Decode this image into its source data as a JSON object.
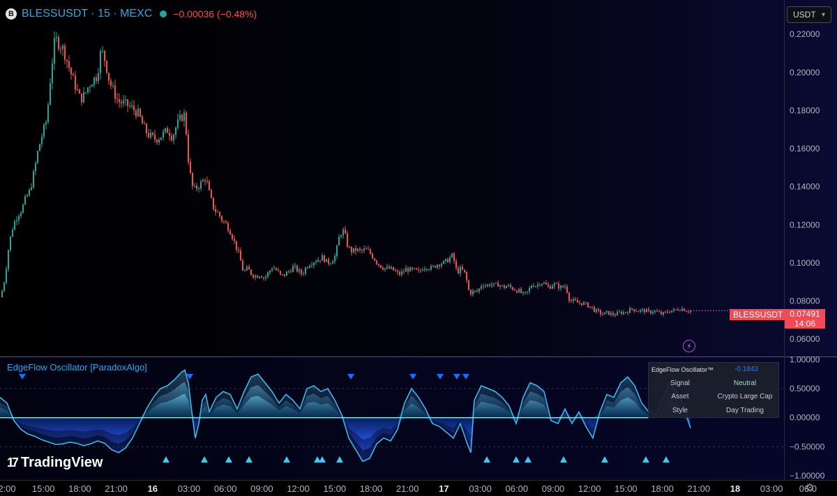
{
  "header": {
    "logo_letter": "B",
    "symbol": "BLESSUSDT · 15 · MEXC",
    "change": "−0.00036 (−0.48%)"
  },
  "currency": {
    "label": "USDT"
  },
  "price_tag": {
    "symbol": "BLESSUSDT",
    "price": "0.07491",
    "countdown": "14:06"
  },
  "oscillator": {
    "title": "EdgeFlow Oscillator [ParadoxAlgo]",
    "table": {
      "title": "EdgeFlow Oscillator™",
      "value": "-0.1843",
      "rows": [
        {
          "key": "Signal",
          "value": "Neutral"
        },
        {
          "key": "Asset",
          "value": "Crypto Large Cap"
        },
        {
          "key": "Style",
          "value": "Day Trading"
        }
      ]
    }
  },
  "branding": {
    "name": "TradingView",
    "mark": "17"
  },
  "icons": {
    "bolt": "lightning-icon",
    "settings": "gear-icon",
    "chevron": "chevron-down-icon"
  },
  "colors": {
    "up": "#26a69a",
    "down": "#ef5350",
    "accent": "#2fa6e6",
    "oscillator": "#3fb8e8",
    "bull_marker": "#3fc8f0",
    "bear_marker": "#1e6cff"
  },
  "chart_data": [
    {
      "type": "candlestick",
      "title": "BLESSUSDT · 15 · MEXC",
      "yaxis_ticks": [
        "0.22000",
        "0.20000",
        "0.18000",
        "0.16000",
        "0.14000",
        "0.12000",
        "0.10000",
        "0.08000",
        "0.06000"
      ],
      "ylim": [
        0.052,
        0.238
      ],
      "xaxis_ticks": [
        "2:00",
        "15:00",
        "18:00",
        "21:00",
        "16",
        "03:00",
        "06:00",
        "09:00",
        "12:00",
        "15:00",
        "18:00",
        "21:00",
        "17",
        "03:00",
        "06:00",
        "09:00",
        "12:00",
        "15:00",
        "18:00",
        "21:00",
        "18",
        "03:00",
        "06:0"
      ],
      "bold_ticks": [
        "16",
        "17",
        "18"
      ],
      "last_price": 0.07491,
      "close_path": [
        [
          0,
          0.082
        ],
        [
          6,
          0.092
        ],
        [
          12,
          0.11
        ],
        [
          18,
          0.12
        ],
        [
          24,
          0.125
        ],
        [
          30,
          0.128
        ],
        [
          36,
          0.134
        ],
        [
          42,
          0.138
        ],
        [
          48,
          0.148
        ],
        [
          54,
          0.16
        ],
        [
          60,
          0.168
        ],
        [
          66,
          0.175
        ],
        [
          72,
          0.2
        ],
        [
          78,
          0.218
        ],
        [
          84,
          0.215
        ],
        [
          90,
          0.212
        ],
        [
          96,
          0.205
        ],
        [
          102,
          0.198
        ],
        [
          108,
          0.192
        ],
        [
          114,
          0.186
        ],
        [
          120,
          0.188
        ],
        [
          126,
          0.193
        ],
        [
          132,
          0.196
        ],
        [
          138,
          0.198
        ],
        [
          144,
          0.212
        ],
        [
          150,
          0.206
        ],
        [
          156,
          0.195
        ],
        [
          162,
          0.19
        ],
        [
          168,
          0.185
        ],
        [
          174,
          0.184
        ],
        [
          180,
          0.183
        ],
        [
          186,
          0.182
        ],
        [
          192,
          0.18
        ],
        [
          198,
          0.178
        ],
        [
          204,
          0.172
        ],
        [
          210,
          0.168
        ],
        [
          216,
          0.166
        ],
        [
          222,
          0.165
        ],
        [
          228,
          0.166
        ],
        [
          234,
          0.168
        ],
        [
          240,
          0.17
        ],
        [
          246,
          0.166
        ],
        [
          252,
          0.172
        ],
        [
          258,
          0.176
        ],
        [
          264,
          0.178
        ],
        [
          270,
          0.15
        ],
        [
          276,
          0.138
        ],
        [
          282,
          0.14
        ],
        [
          288,
          0.142
        ],
        [
          294,
          0.145
        ],
        [
          300,
          0.135
        ],
        [
          306,
          0.128
        ],
        [
          312,
          0.126
        ],
        [
          318,
          0.122
        ],
        [
          324,
          0.12
        ],
        [
          330,
          0.116
        ],
        [
          336,
          0.11
        ],
        [
          342,
          0.104
        ],
        [
          348,
          0.095
        ],
        [
          354,
          0.097
        ],
        [
          360,
          0.094
        ],
        [
          366,
          0.093
        ],
        [
          372,
          0.094
        ],
        [
          378,
          0.092
        ],
        [
          384,
          0.095
        ],
        [
          390,
          0.098
        ],
        [
          396,
          0.096
        ],
        [
          402,
          0.093
        ],
        [
          408,
          0.094
        ],
        [
          414,
          0.096
        ],
        [
          420,
          0.098
        ],
        [
          426,
          0.096
        ],
        [
          432,
          0.094
        ],
        [
          438,
          0.098
        ],
        [
          444,
          0.1
        ],
        [
          450,
          0.101
        ],
        [
          456,
          0.102
        ],
        [
          462,
          0.103
        ],
        [
          468,
          0.1
        ],
        [
          474,
          0.101
        ],
        [
          480,
          0.104
        ],
        [
          486,
          0.115
        ],
        [
          492,
          0.117
        ],
        [
          498,
          0.108
        ],
        [
          504,
          0.106
        ],
        [
          510,
          0.107
        ],
        [
          516,
          0.106
        ],
        [
          522,
          0.107
        ],
        [
          528,
          0.106
        ],
        [
          534,
          0.103
        ],
        [
          540,
          0.1
        ],
        [
          546,
          0.098
        ],
        [
          552,
          0.097
        ],
        [
          558,
          0.097
        ],
        [
          564,
          0.096
        ],
        [
          570,
          0.094
        ],
        [
          576,
          0.095
        ],
        [
          582,
          0.097
        ],
        [
          588,
          0.096
        ],
        [
          594,
          0.096
        ],
        [
          600,
          0.095
        ],
        [
          606,
          0.098
        ],
        [
          612,
          0.098
        ],
        [
          618,
          0.097
        ],
        [
          624,
          0.099
        ],
        [
          630,
          0.1
        ],
        [
          636,
          0.1
        ],
        [
          642,
          0.102
        ],
        [
          648,
          0.104
        ],
        [
          654,
          0.095
        ],
        [
          660,
          0.097
        ],
        [
          666,
          0.094
        ],
        [
          672,
          0.084
        ],
        [
          678,
          0.085
        ],
        [
          684,
          0.085
        ],
        [
          690,
          0.089
        ],
        [
          696,
          0.088
        ],
        [
          702,
          0.089
        ],
        [
          708,
          0.088
        ],
        [
          714,
          0.089
        ],
        [
          720,
          0.087
        ],
        [
          726,
          0.088
        ],
        [
          732,
          0.087
        ],
        [
          738,
          0.086
        ],
        [
          744,
          0.085
        ],
        [
          750,
          0.083
        ],
        [
          756,
          0.085
        ],
        [
          762,
          0.089
        ],
        [
          768,
          0.088
        ],
        [
          774,
          0.09
        ],
        [
          780,
          0.089
        ],
        [
          786,
          0.087
        ],
        [
          792,
          0.089
        ],
        [
          798,
          0.088
        ],
        [
          804,
          0.087
        ],
        [
          810,
          0.088
        ],
        [
          816,
          0.08
        ],
        [
          822,
          0.08
        ],
        [
          828,
          0.079
        ],
        [
          834,
          0.079
        ],
        [
          840,
          0.078
        ],
        [
          846,
          0.077
        ],
        [
          852,
          0.075
        ],
        [
          858,
          0.074
        ],
        [
          864,
          0.073
        ],
        [
          870,
          0.074
        ],
        [
          876,
          0.073
        ],
        [
          882,
          0.073
        ],
        [
          888,
          0.074
        ],
        [
          894,
          0.074
        ],
        [
          900,
          0.075
        ],
        [
          906,
          0.076
        ],
        [
          912,
          0.075
        ],
        [
          918,
          0.075
        ],
        [
          924,
          0.075
        ],
        [
          930,
          0.074
        ],
        [
          936,
          0.075
        ],
        [
          942,
          0.074
        ],
        [
          948,
          0.073
        ],
        [
          954,
          0.074
        ],
        [
          960,
          0.075
        ],
        [
          966,
          0.075
        ],
        [
          972,
          0.076
        ],
        [
          978,
          0.076
        ],
        [
          984,
          0.075
        ],
        [
          990,
          0.07491
        ]
      ]
    },
    {
      "type": "line",
      "title": "EdgeFlow Oscillator [ParadoxAlgo]",
      "yaxis_ticks": [
        "1.00000",
        "0.50000",
        "0.00000",
        "−0.50000",
        "−1.00000"
      ],
      "ylim": [
        -1.07,
        1.04
      ],
      "zero_line": 0,
      "series": [
        {
          "values": [
            [
              0,
              0.35
            ],
            [
              10,
              0.25
            ],
            [
              20,
              -0.05
            ],
            [
              30,
              -0.2
            ],
            [
              40,
              -0.28
            ],
            [
              50,
              -0.32
            ],
            [
              60,
              -0.38
            ],
            [
              70,
              -0.42
            ],
            [
              80,
              -0.46
            ],
            [
              90,
              -0.45
            ],
            [
              100,
              -0.42
            ],
            [
              110,
              -0.44
            ],
            [
              120,
              -0.48
            ],
            [
              130,
              -0.45
            ],
            [
              140,
              -0.4
            ],
            [
              150,
              -0.44
            ],
            [
              160,
              -0.55
            ],
            [
              170,
              -0.6
            ],
            [
              180,
              -0.52
            ],
            [
              190,
              -0.35
            ],
            [
              200,
              -0.1
            ],
            [
              210,
              0.15
            ],
            [
              220,
              0.35
            ],
            [
              230,
              0.5
            ],
            [
              240,
              0.55
            ],
            [
              250,
              0.65
            ],
            [
              260,
              0.78
            ],
            [
              265,
              0.82
            ],
            [
              270,
              0.6
            ],
            [
              275,
              0.1
            ],
            [
              280,
              -0.35
            ],
            [
              285,
              -0.1
            ],
            [
              290,
              0.3
            ],
            [
              295,
              0.4
            ],
            [
              300,
              0.1
            ],
            [
              310,
              0.35
            ],
            [
              320,
              0.45
            ],
            [
              330,
              0.4
            ],
            [
              340,
              0.15
            ],
            [
              350,
              0.45
            ],
            [
              360,
              0.7
            ],
            [
              370,
              0.75
            ],
            [
              380,
              0.6
            ],
            [
              390,
              0.45
            ],
            [
              400,
              0.25
            ],
            [
              410,
              0.4
            ],
            [
              420,
              0.3
            ],
            [
              430,
              0.15
            ],
            [
              440,
              0.5
            ],
            [
              450,
              0.55
            ],
            [
              460,
              0.45
            ],
            [
              470,
              0.5
            ],
            [
              480,
              0.3
            ],
            [
              490,
              0.05
            ],
            [
              500,
              -0.35
            ],
            [
              510,
              -0.55
            ],
            [
              520,
              -0.75
            ],
            [
              530,
              -0.7
            ],
            [
              540,
              -0.45
            ],
            [
              550,
              -0.35
            ],
            [
              560,
              -0.4
            ],
            [
              570,
              -0.2
            ],
            [
              580,
              0.25
            ],
            [
              590,
              0.5
            ],
            [
              600,
              0.35
            ],
            [
              610,
              0.15
            ],
            [
              620,
              -0.1
            ],
            [
              630,
              -0.15
            ],
            [
              640,
              -0.25
            ],
            [
              650,
              -0.35
            ],
            [
              660,
              -0.1
            ],
            [
              670,
              -0.45
            ],
            [
              675,
              -0.6
            ],
            [
              680,
              0.3
            ],
            [
              690,
              0.55
            ],
            [
              700,
              0.5
            ],
            [
              710,
              0.45
            ],
            [
              720,
              0.35
            ],
            [
              730,
              0.2
            ],
            [
              740,
              -0.1
            ],
            [
              750,
              0.35
            ],
            [
              760,
              0.6
            ],
            [
              770,
              0.55
            ],
            [
              780,
              0.45
            ],
            [
              790,
              -0.05
            ],
            [
              800,
              -0.1
            ],
            [
              810,
              0.15
            ],
            [
              820,
              -0.1
            ],
            [
              830,
              0.1
            ],
            [
              840,
              -0.15
            ],
            [
              850,
              -0.35
            ],
            [
              860,
              0.1
            ],
            [
              870,
              0.4
            ],
            [
              880,
              0.35
            ],
            [
              890,
              0.6
            ],
            [
              900,
              0.7
            ],
            [
              910,
              0.55
            ],
            [
              920,
              0.25
            ],
            [
              930,
              0.1
            ],
            [
              940,
              0.05
            ],
            [
              950,
              0.3
            ],
            [
              960,
              0.6
            ],
            [
              970,
              0.45
            ],
            [
              980,
              0.2
            ],
            [
              990,
              -0.18
            ]
          ]
        }
      ],
      "bull_markers_x": [
        238,
        293,
        328,
        357,
        411,
        455,
        462,
        487,
        698,
        740,
        757,
        808,
        867,
        926,
        955
      ],
      "bear_markers_x": [
        32,
        272,
        503,
        592,
        631,
        655,
        668
      ]
    }
  ]
}
